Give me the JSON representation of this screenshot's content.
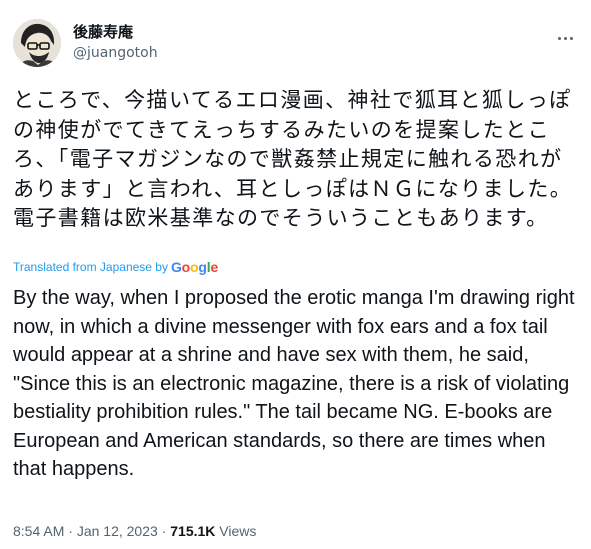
{
  "author": {
    "display_name": "後藤寿庵",
    "handle": "@juangotoh",
    "avatar_icon": "avatar-illustration"
  },
  "tweet": {
    "text_jp": "ところで、今描いてるエロ漫画、神社で狐耳と狐しっぽの神使がでてきてえっちするみたいのを提案したところ、「電子マガジンなので獣姦禁止規定に触れる恐れがあります」と言われ、耳としっぽはＮＧになりました。電子書籍は欧米基準なのでそういうこともあります。",
    "translated_label": "Translated from Japanese by",
    "translator_brand": "Google",
    "text_en": "By the way, when I proposed the erotic manga I'm drawing right now, in which a divine messenger with fox ears and a fox tail would appear at a shrine and have sex with them, he said, \"Since this is an electronic magazine, there is a risk of violating bestiality prohibition rules.\" The tail became NG. E-books are European and American standards, so there are times when that happens.",
    "time": "8:54 AM",
    "separator": "·",
    "date": "Jan 12, 2023",
    "views_count": "715.1K",
    "views_label": "Views"
  },
  "colors": {
    "link": "#1d9bf0",
    "secondary_text": "#536471",
    "primary_text": "#0f1419"
  },
  "icons": {
    "more": "more-horizontal-icon"
  }
}
